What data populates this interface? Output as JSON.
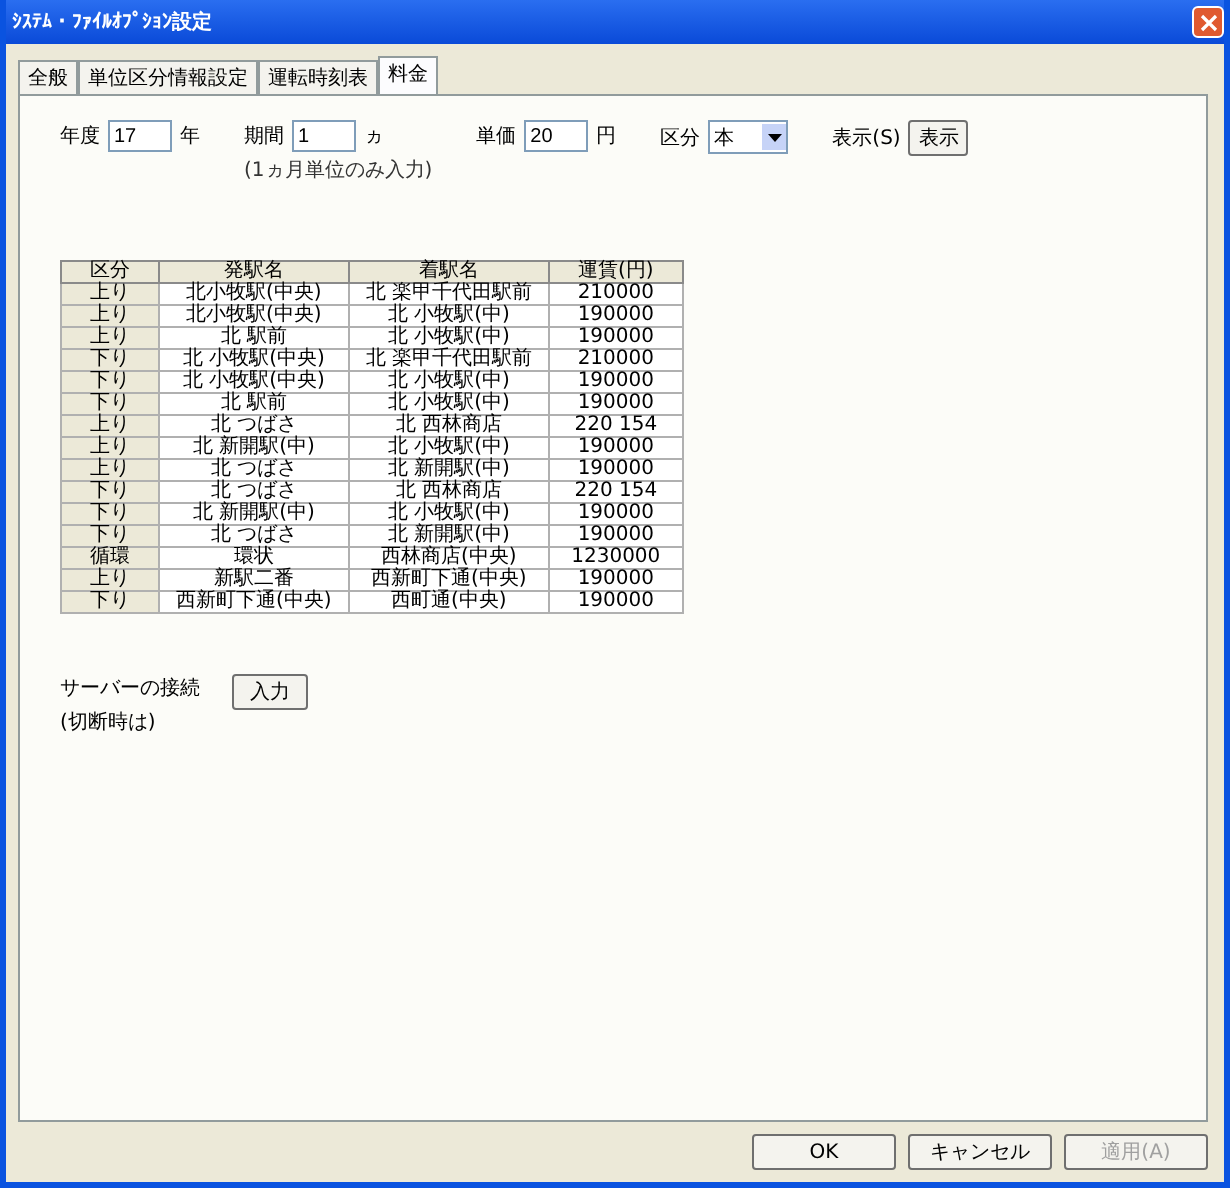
{
  "window": {
    "title": "ｼｽﾃﾑ・ﾌｧｲﾙｵﾌﾟｼｮﾝ設定"
  },
  "tabs": [
    {
      "label": "全般",
      "selected": false
    },
    {
      "label": "単位区分情報設定",
      "selected": false
    },
    {
      "label": "運転時刻表",
      "selected": false
    },
    {
      "label": "料金",
      "selected": true
    }
  ],
  "filters": [
    {
      "label": "年度",
      "value": "17",
      "unit": "年"
    },
    {
      "label": "期間",
      "value": "1",
      "unit": "ヵ",
      "note": "(1ヵ月単位のみ入力)"
    },
    {
      "label": "単価",
      "value": "20",
      "unit": "円"
    }
  ],
  "category": {
    "label": "区分",
    "value": "本"
  },
  "show_button": {
    "label": "表示(S)",
    "text": "表示"
  },
  "table": {
    "columns": [
      "区分",
      "発駅名",
      "着駅名",
      "運賃(円)"
    ],
    "rows": [
      [
        "上り",
        "北小牧駅(中央)",
        "北 楽甲千代田駅前",
        "210000"
      ],
      [
        "上り",
        "北小牧駅(中央)",
        "北 小牧駅(中)",
        "190000"
      ],
      [
        "上り",
        "北 駅前",
        "北 小牧駅(中)",
        "190000"
      ],
      [
        "下り",
        "北 小牧駅(中央)",
        "北 楽甲千代田駅前",
        "210000"
      ],
      [
        "下り",
        "北 小牧駅(中央)",
        "北 小牧駅(中)",
        "190000"
      ],
      [
        "下り",
        "北 駅前",
        "北 小牧駅(中)",
        "190000"
      ],
      [
        "上り",
        "北 つばさ",
        "北 西林商店",
        "220 154"
      ],
      [
        "上り",
        "北 新開駅(中)",
        "北 小牧駅(中)",
        "190000"
      ],
      [
        "上り",
        "北 つばさ",
        "北 新開駅(中)",
        "190000"
      ],
      [
        "下り",
        "北 つばさ",
        "北 西林商店",
        "220 154"
      ],
      [
        "下り",
        "北 新開駅(中)",
        "北 小牧駅(中)",
        "190000"
      ],
      [
        "下り",
        "北 つばさ",
        "北 新開駅(中)",
        "190000"
      ],
      [
        "循環",
        "環状",
        "西林商店(中央)",
        "1230000"
      ],
      [
        "上り",
        "新駅二番",
        "西新町下通(中央)",
        "190000"
      ],
      [
        "下り",
        "西新町下通(中央)",
        "西町通(中央)",
        "190000"
      ]
    ]
  },
  "server": {
    "label": "サーバーの接続",
    "sub": "(切断時は)",
    "button": "入力"
  },
  "buttons": [
    {
      "label": "OK",
      "disabled": false
    },
    {
      "label": "キャンセル",
      "disabled": false
    },
    {
      "label": "適用(A)",
      "disabled": true
    }
  ]
}
